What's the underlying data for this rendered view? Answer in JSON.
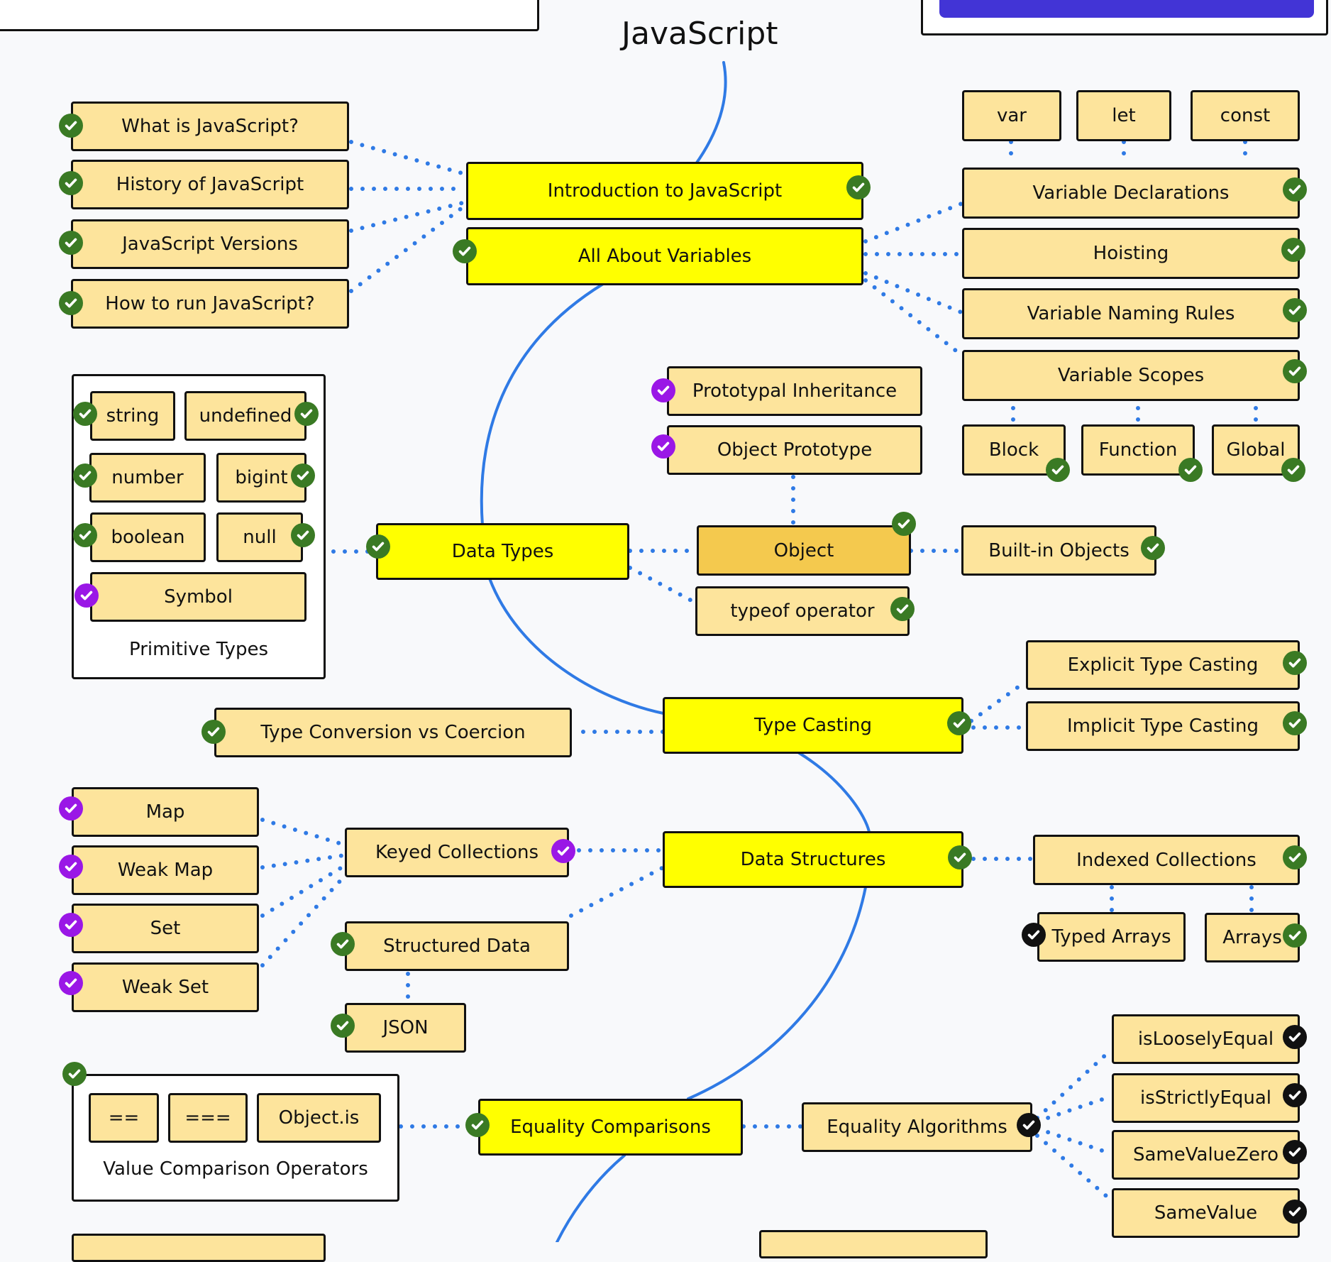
{
  "title": "JavaScript",
  "colors": {
    "main_node": "#ffff00",
    "sub_node": "#fde49c",
    "object_node": "#f4c94e",
    "done_check": "#3a7a24",
    "alternative_check": "#9a17e6",
    "optional_check": "#111111",
    "path_line": "#2f7ae5",
    "top_button": "#4234d6"
  },
  "top_right_button": {
    "label": ""
  },
  "main_nodes": {
    "intro": "Introduction to JavaScript",
    "variables": "All About Variables",
    "data_types": "Data Types",
    "type_casting": "Type Casting",
    "data_structures": "Data Structures",
    "equality": "Equality Comparisons"
  },
  "intro_topics": [
    {
      "label": "What is JavaScript?",
      "status": "done"
    },
    {
      "label": "History of JavaScript",
      "status": "done"
    },
    {
      "label": "JavaScript Versions",
      "status": "done"
    },
    {
      "label": "How to run JavaScript?",
      "status": "done"
    }
  ],
  "declaration_keywords": [
    "var",
    "let",
    "const"
  ],
  "variable_topics": [
    {
      "label": "Variable Declarations",
      "status": "done"
    },
    {
      "label": "Hoisting",
      "status": "done"
    },
    {
      "label": "Variable Naming Rules",
      "status": "done"
    },
    {
      "label": "Variable Scopes",
      "status": "done"
    }
  ],
  "scopes": [
    {
      "label": "Block",
      "status": "done"
    },
    {
      "label": "Function",
      "status": "done"
    },
    {
      "label": "Global",
      "status": "done"
    }
  ],
  "primitive_types": {
    "group_label": "Primitive Types",
    "items": [
      {
        "label": "string",
        "status": "done"
      },
      {
        "label": "undefined",
        "status": "done"
      },
      {
        "label": "number",
        "status": "done"
      },
      {
        "label": "bigint",
        "status": "done"
      },
      {
        "label": "boolean",
        "status": "done"
      },
      {
        "label": "null",
        "status": "done"
      },
      {
        "label": "Symbol",
        "status": "alternative"
      }
    ]
  },
  "object_topics": {
    "prototypal_inheritance": {
      "label": "Prototypal Inheritance",
      "status": "alternative"
    },
    "object_prototype": {
      "label": "Object Prototype",
      "status": "alternative"
    },
    "object": {
      "label": "Object",
      "status": "done"
    },
    "typeof": {
      "label": "typeof operator",
      "status": "done"
    },
    "builtin": {
      "label": "Built-in Objects",
      "status": "done"
    }
  },
  "type_casting_topics": [
    {
      "label": "Explicit Type Casting",
      "status": "done"
    },
    {
      "label": "Implicit Type Casting",
      "status": "done"
    }
  ],
  "type_conversion": {
    "label": "Type Conversion vs Coercion",
    "status": "done"
  },
  "keyed_collections": {
    "label": "Keyed Collections",
    "status": "alternative",
    "items": [
      {
        "label": "Map",
        "status": "alternative"
      },
      {
        "label": "Weak Map",
        "status": "alternative"
      },
      {
        "label": "Set",
        "status": "alternative"
      },
      {
        "label": "Weak Set",
        "status": "alternative"
      }
    ]
  },
  "structured_data": {
    "label": "Structured Data",
    "status": "done"
  },
  "json_node": {
    "label": "JSON",
    "status": "done"
  },
  "indexed_collections": {
    "label": "Indexed Collections",
    "status": "done",
    "items": [
      {
        "label": "Typed Arrays",
        "status": "optional"
      },
      {
        "label": "Arrays",
        "status": "done"
      }
    ]
  },
  "value_comparison": {
    "group_label": "Value Comparison Operators",
    "status": "done",
    "items": [
      "==",
      "===",
      "Object.is"
    ]
  },
  "equality_algorithms": {
    "label": "Equality Algorithms",
    "status": "optional",
    "items": [
      {
        "label": "isLooselyEqual",
        "status": "optional"
      },
      {
        "label": "isStrictlyEqual",
        "status": "optional"
      },
      {
        "label": "SameValueZero",
        "status": "optional"
      },
      {
        "label": "SameValue",
        "status": "optional"
      }
    ]
  }
}
